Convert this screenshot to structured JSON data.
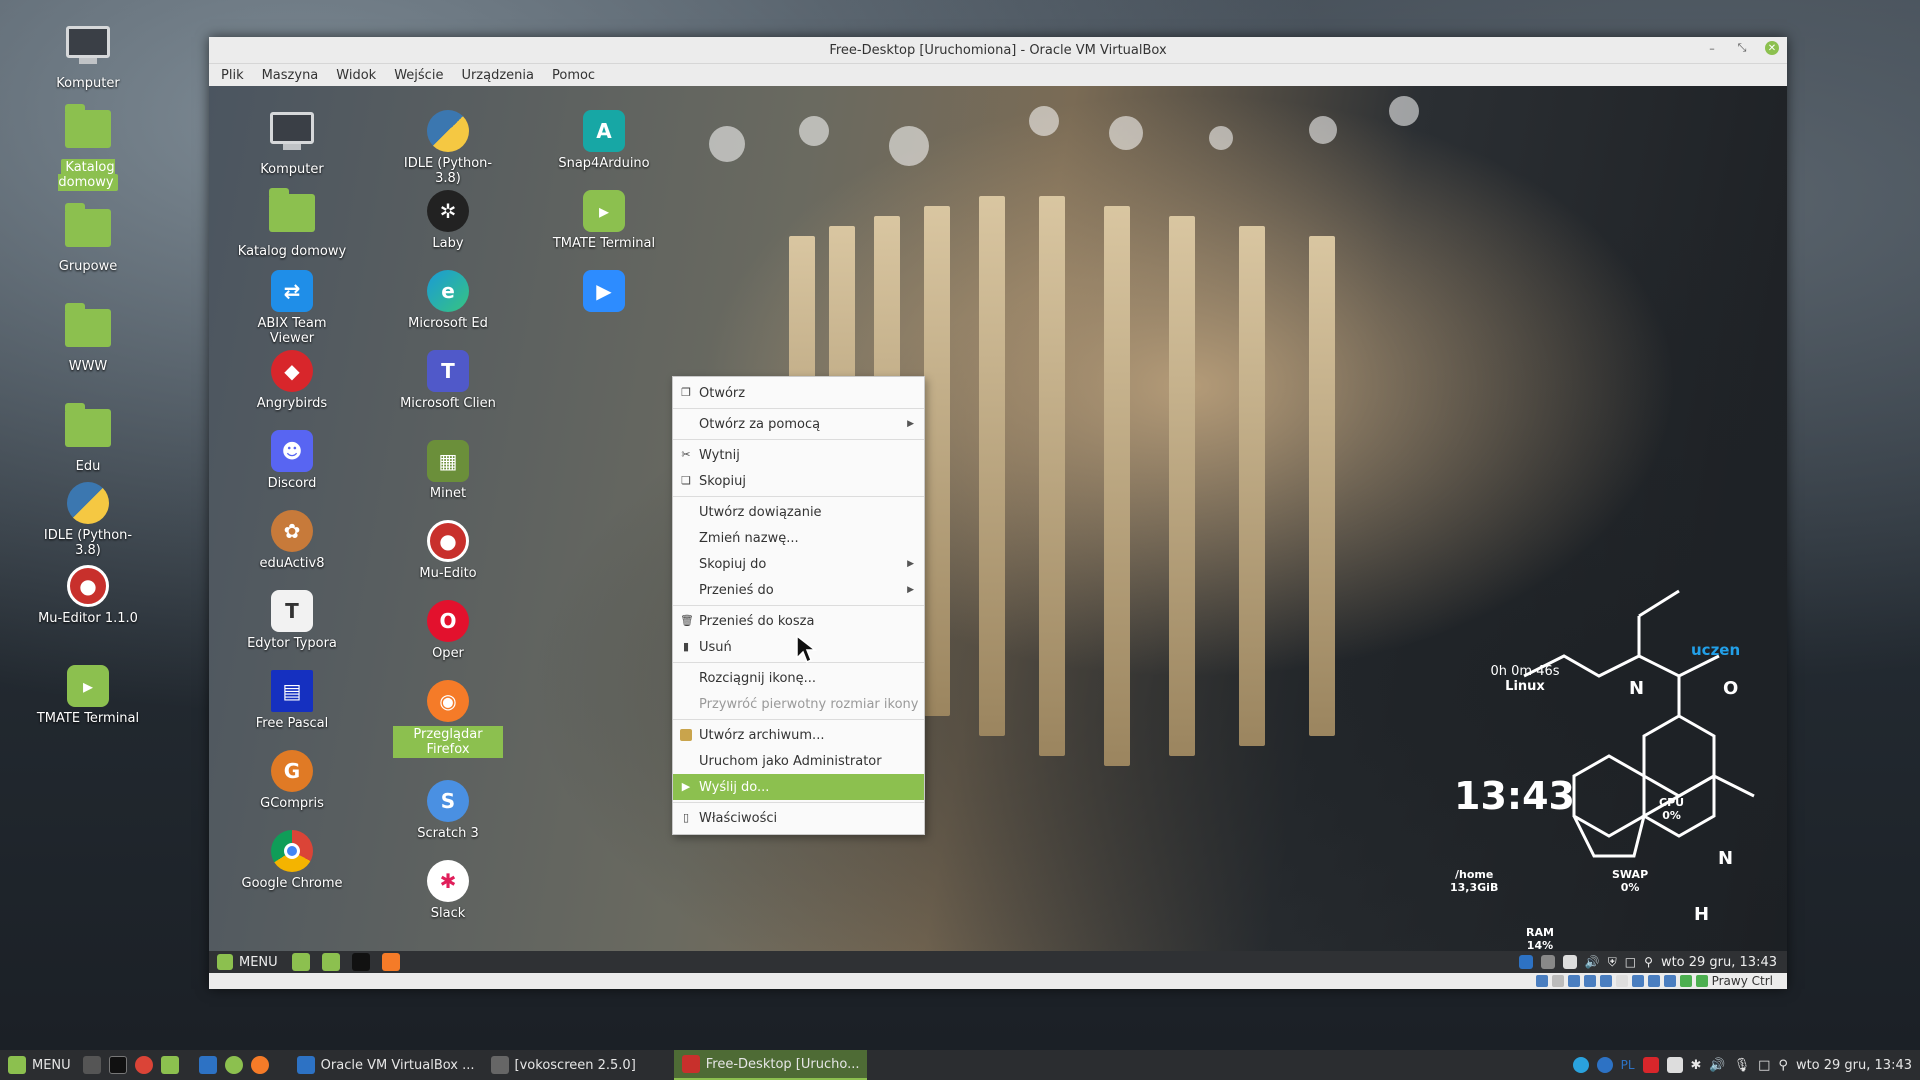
{
  "host_desktop": {
    "icons": [
      {
        "label": "Komputer"
      },
      {
        "label": "Katalog domowy"
      },
      {
        "label": "Grupowe"
      },
      {
        "label": "WWW"
      },
      {
        "label": "Edu"
      },
      {
        "label": "IDLE (Python-3.8)"
      },
      {
        "label": "Mu-Editor 1.1.0"
      },
      {
        "label": "TMATE Terminal"
      }
    ]
  },
  "vbox": {
    "title": "Free-Desktop [Uruchomiona] - Oracle VM VirtualBox",
    "menu": [
      "Plik",
      "Maszyna",
      "Widok",
      "Wejście",
      "Urządzenia",
      "Pomoc"
    ],
    "status_host_key": "Prawy Ctrl"
  },
  "guest_desktop": {
    "col1": [
      {
        "label": "Komputer"
      },
      {
        "label": "Katalog domowy"
      },
      {
        "label": "ABIX Team Viewer"
      },
      {
        "label": "Angrybirds"
      },
      {
        "label": "Discord"
      },
      {
        "label": "eduActiv8"
      },
      {
        "label": "Edytor Typora"
      },
      {
        "label": "Free Pascal"
      },
      {
        "label": "GCompris"
      },
      {
        "label": "Google Chrome"
      }
    ],
    "col2": [
      {
        "label": "IDLE (Python-3.8)"
      },
      {
        "label": "Laby"
      },
      {
        "label": "Microsoft Ed"
      },
      {
        "label": "Microsoft Clien"
      },
      {
        "label": "Minet"
      },
      {
        "label": "Mu-Edito"
      },
      {
        "label": "Oper"
      },
      {
        "label": "Przeglądar Firefox"
      },
      {
        "label": "Scratch 3"
      },
      {
        "label": "Slack"
      }
    ],
    "col3": [
      {
        "label": "Snap4Arduino"
      },
      {
        "label": "TMATE Terminal"
      }
    ]
  },
  "context_menu": {
    "items": [
      {
        "label": "Otwórz",
        "icon": "open-icon"
      },
      {
        "label": "Otwórz za pomocą",
        "submenu": true
      },
      {
        "label": "Wytnij",
        "icon": "cut-icon"
      },
      {
        "label": "Skopiuj",
        "icon": "copy-icon"
      },
      {
        "label": "Utwórz dowiązanie"
      },
      {
        "label": "Zmień nazwę..."
      },
      {
        "label": "Skopiuj do",
        "submenu": true
      },
      {
        "label": "Przenieś do",
        "submenu": true
      },
      {
        "label": "Przenieś do kosza",
        "icon": "trash-icon"
      },
      {
        "label": "Usuń",
        "icon": "delete-icon"
      },
      {
        "label": "Rozciągnij ikonę..."
      },
      {
        "label": "Przywróć pierwotny rozmiar ikony",
        "disabled": true
      },
      {
        "label": "Utwórz archiwum...",
        "icon": "archive-icon"
      },
      {
        "label": "Uruchom jako Administrator"
      },
      {
        "label": "Wyślij do...",
        "icon": "send-icon",
        "active": true
      },
      {
        "label": "Właściwości",
        "icon": "properties-icon"
      }
    ]
  },
  "conky": {
    "uptime": "0h 0m 46s",
    "os": "Linux",
    "user": "uczen",
    "time": "13:43",
    "cpu_label": "CPU",
    "cpu_value": "0%",
    "swap_label": "SWAP",
    "swap_value": "0%",
    "home_label": "/home",
    "home_value": "13,3GiB",
    "ram_label": "RAM",
    "ram_value": "14%",
    "atom_n": "N",
    "atom_o": "O",
    "atom_h": "H"
  },
  "guest_panel": {
    "menu_label": "MENU",
    "clock": "wto 29 gru, 13:43"
  },
  "host_panel": {
    "menu_label": "MENU",
    "tasks": [
      {
        "label": "Oracle VM VirtualBox ..."
      },
      {
        "label": "[vokoscreen 2.5.0]"
      },
      {
        "label": "Free-Desktop [Urucho..."
      }
    ],
    "tray_text": "PL",
    "clock": "wto 29 gru, 13:43"
  },
  "colors": {
    "accent": "#8cc04f",
    "panel": "#2b2d30"
  }
}
